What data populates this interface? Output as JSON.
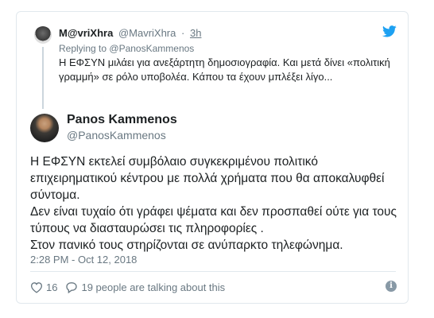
{
  "colors": {
    "text": "#1c2022",
    "muted": "#697882",
    "twitter_blue": "#1da1f2",
    "border": "#e1e8ed"
  },
  "reply": {
    "display_name": "M@vriXhra",
    "handle": "@MavriXhra",
    "separator": "·",
    "time": "3h",
    "replying_prefix": "Replying to",
    "replying_to": "@PanosKammenos",
    "text": "Η ΕΦΣΥΝ μιλάει για ανεξάρτητη δημοσιογραφία. Και μετά δίνει «πολιτική γραμμή» σε ρόλο υποβολέα. Κάπου τα έχουν μπλέξει λίγο...",
    "icon": "twitter-bird-icon"
  },
  "tweet": {
    "display_name": "Panos Kammenos",
    "handle": "@PanosKammenos",
    "paragraphs": [
      "Η ΕΦΣΥΝ εκτελεί συμβόλαιο συγκεκριμένου πολιτικό επιχειρηματικού κέντρου με  πολλά χρήματα που θα αποκαλυφθεί σύντομα.",
      "Δεν είναι τυχαίο ότι γράφει ψέματα και δεν προσπαθεί ούτε για τους τύπους να διασταυρώσει τις πληροφορίες .",
      "Στον πανικό τους στηρίζονται σε ανύπαρκτο τηλεφώνημα."
    ],
    "timestamp": "2:28 PM - Oct 12, 2018"
  },
  "actions": {
    "likes": "16",
    "conversation": "19 people are talking about this",
    "icons": [
      "heart-icon",
      "comment-icon",
      "info-icon"
    ]
  }
}
